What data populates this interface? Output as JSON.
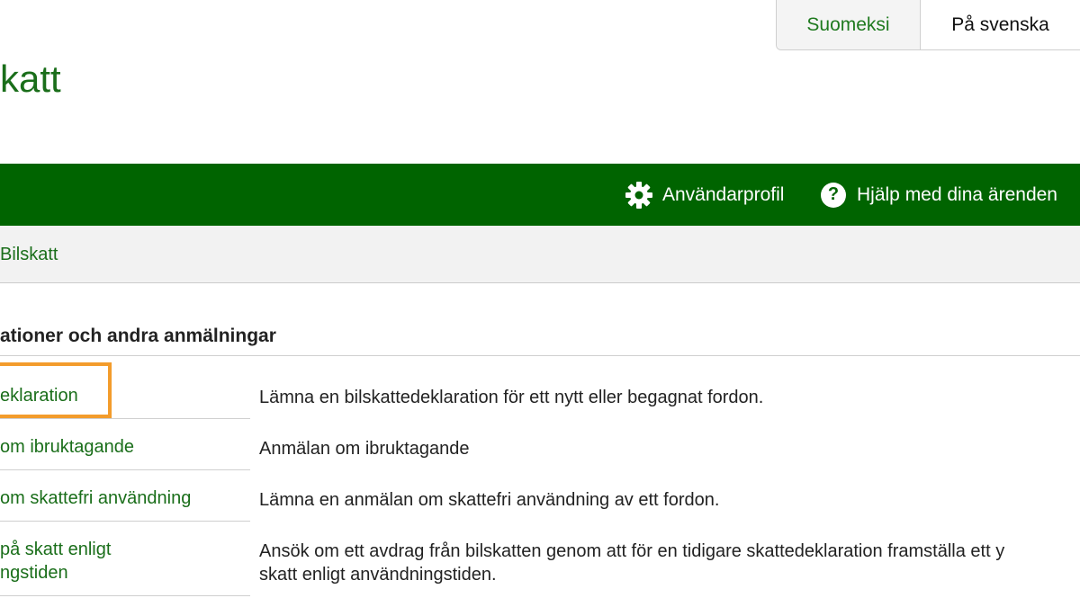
{
  "language_switch": {
    "finnish": "Suomeksi",
    "swedish": "På svenska"
  },
  "site_title": "katt",
  "navbar": {
    "profile_icon": "gear-icon",
    "profile_label": "Användarprofil",
    "help_icon": "question-circle-icon",
    "help_symbol": "?",
    "help_label": "Hjälp med dina ärenden"
  },
  "breadcrumb": {
    "current": "Bilskatt"
  },
  "section": {
    "heading": "ationer och andra anmälningar",
    "rows": [
      {
        "link": "eklaration",
        "description": "Lämna en bilskattedeklaration för ett nytt eller begagnat fordon.",
        "highlighted": true
      },
      {
        "link": "om ibruktagande",
        "description": "Anmälan om ibruktagande"
      },
      {
        "link": "om skattefri användning",
        "description": "Lämna en anmälan om skattefri användning av ett fordon."
      },
      {
        "link_line1": "på skatt enligt",
        "link_line2": "ngstiden",
        "description_line1": "Ansök om ett avdrag från bilskatten genom att för en tidigare skattedeklaration framställa ett y",
        "description_line2": "skatt enligt användningstiden."
      }
    ]
  },
  "colors": {
    "brand_green": "#006400",
    "link_green": "#1a6e1a",
    "highlight_orange": "#f39c2c",
    "breadcrumb_bg": "#f2f2f2"
  }
}
